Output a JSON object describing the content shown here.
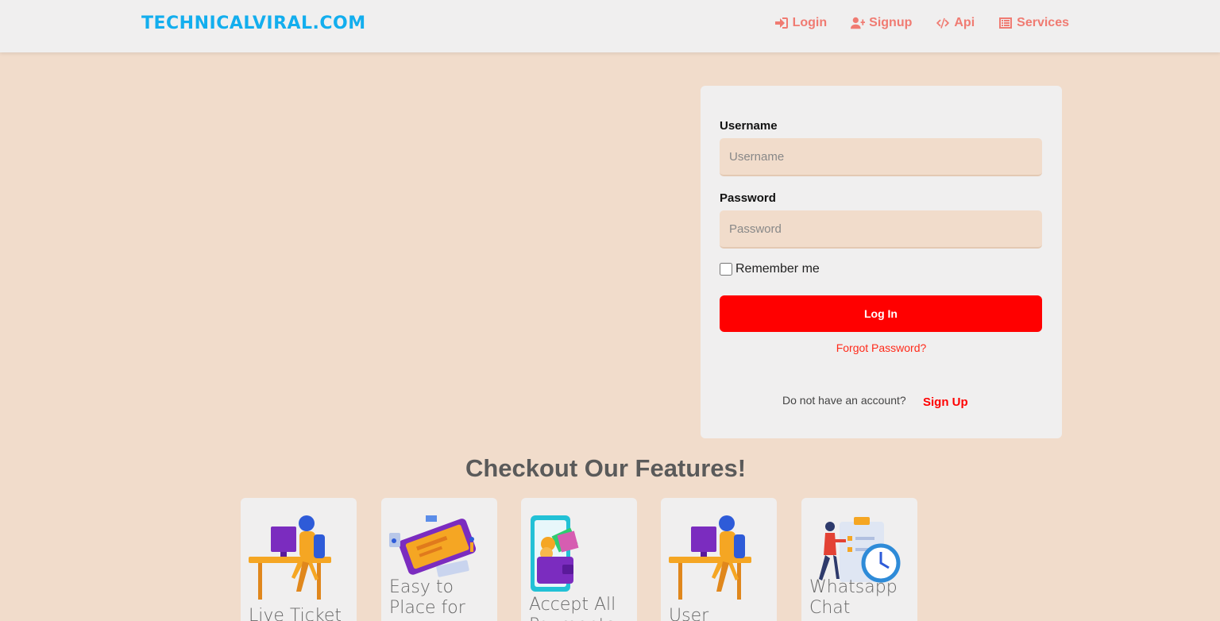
{
  "brand": "TECHNICALVIRAL.COM",
  "nav": {
    "login": "Login",
    "signup": "Signup",
    "api": "Api",
    "services": "Services"
  },
  "form": {
    "username_label": "Username",
    "username_placeholder": "Username",
    "password_label": "Password",
    "password_placeholder": "Password",
    "remember": "Remember me",
    "login_button": "Log In",
    "forgot": "Forgot Password?",
    "no_account": "Do not have an account?",
    "signup": "Sign Up"
  },
  "features": {
    "title": "Checkout Our Features!",
    "cards": [
      {
        "title": "Live Ticket",
        "icon": "desk-woman-illustration"
      },
      {
        "title": "Easy to Place for",
        "icon": "phone-order-illustration"
      },
      {
        "title": "Accept All Payments",
        "icon": "wallet-payment-illustration"
      },
      {
        "title": "User",
        "icon": "desk-woman-illustration"
      },
      {
        "title": "Whatsapp Chat",
        "icon": "clock-checklist-illustration"
      }
    ]
  },
  "colors": {
    "accent": "#13aeee",
    "nav": "#f07b72",
    "button": "#ff0000",
    "background": "#f1dccb"
  }
}
